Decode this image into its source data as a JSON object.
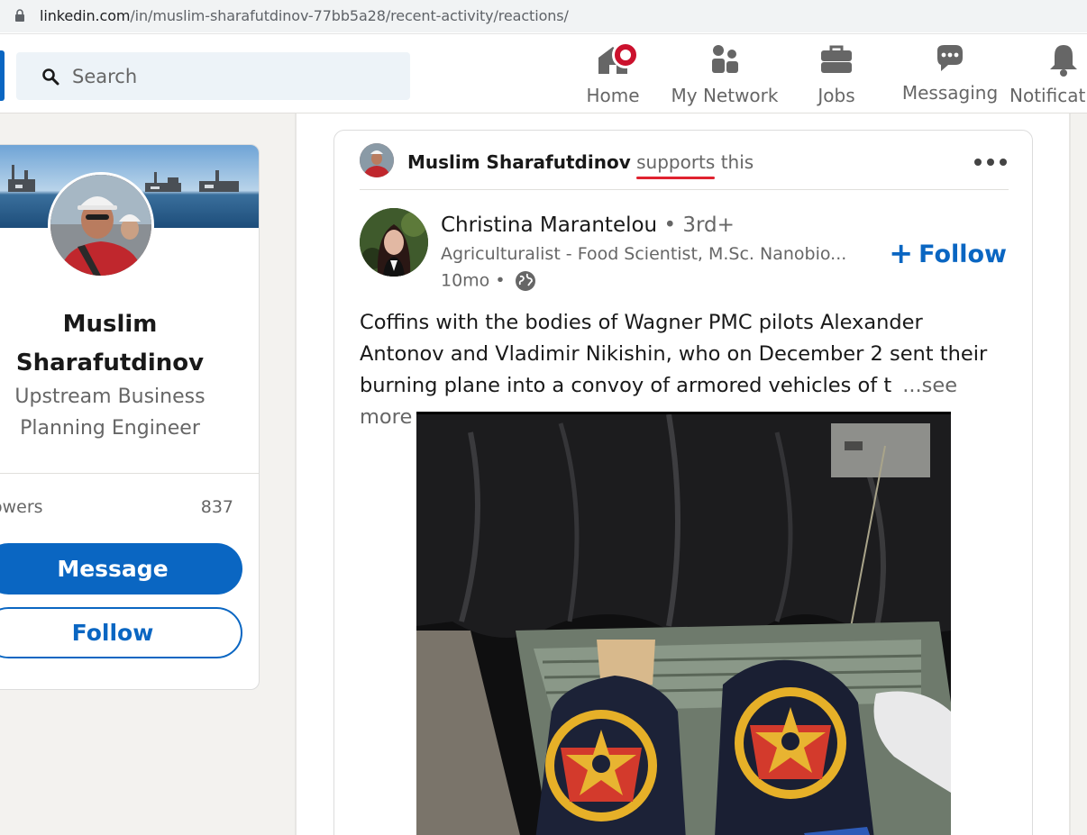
{
  "browser": {
    "url_host": "linkedin.com",
    "url_path": "/in/muslim-sharafutdinov-77bb5a28/recent-activity/reactions/"
  },
  "nav": {
    "search_placeholder": "Search",
    "items": [
      {
        "label": "Home",
        "icon": "home-icon"
      },
      {
        "label": "My Network",
        "icon": "network-icon"
      },
      {
        "label": "Jobs",
        "icon": "briefcase-icon"
      },
      {
        "label": "Messaging",
        "icon": "chat-icon"
      },
      {
        "label": "Notificatio",
        "icon": "bell-icon"
      }
    ]
  },
  "profile": {
    "name_line1": "Muslim",
    "name_line2": "Sharafutdinov",
    "headline_line1": "Upstream Business",
    "headline_line2": "Planning Engineer",
    "followers_label": "owers",
    "followers_count": "837",
    "message_button": "Message",
    "follow_button": "Follow"
  },
  "post": {
    "activity_actor": "Muslim Sharafutdinov",
    "activity_verb": "supports",
    "activity_suffix": "this",
    "author_name": "Christina Marantelou",
    "author_degree": "• 3rd+",
    "author_headline": "Agriculturalist - Food Scientist, M.Sc. Nanobio...",
    "post_time": "10mo •",
    "follow_label": "Follow",
    "text_line1": "Coffins with the bodies of Wagner PMC pilots Alexander",
    "text_line2": "Antonov and Vladimir Nikishin, who on December 2 sent their",
    "text_line3": "burning plane into a convoy of armored vehicles of t",
    "see_more": "...see more"
  },
  "colors": {
    "brand_blue": "#0a66c2",
    "badge_red": "#cb112d",
    "underline_red": "#e0222f"
  }
}
